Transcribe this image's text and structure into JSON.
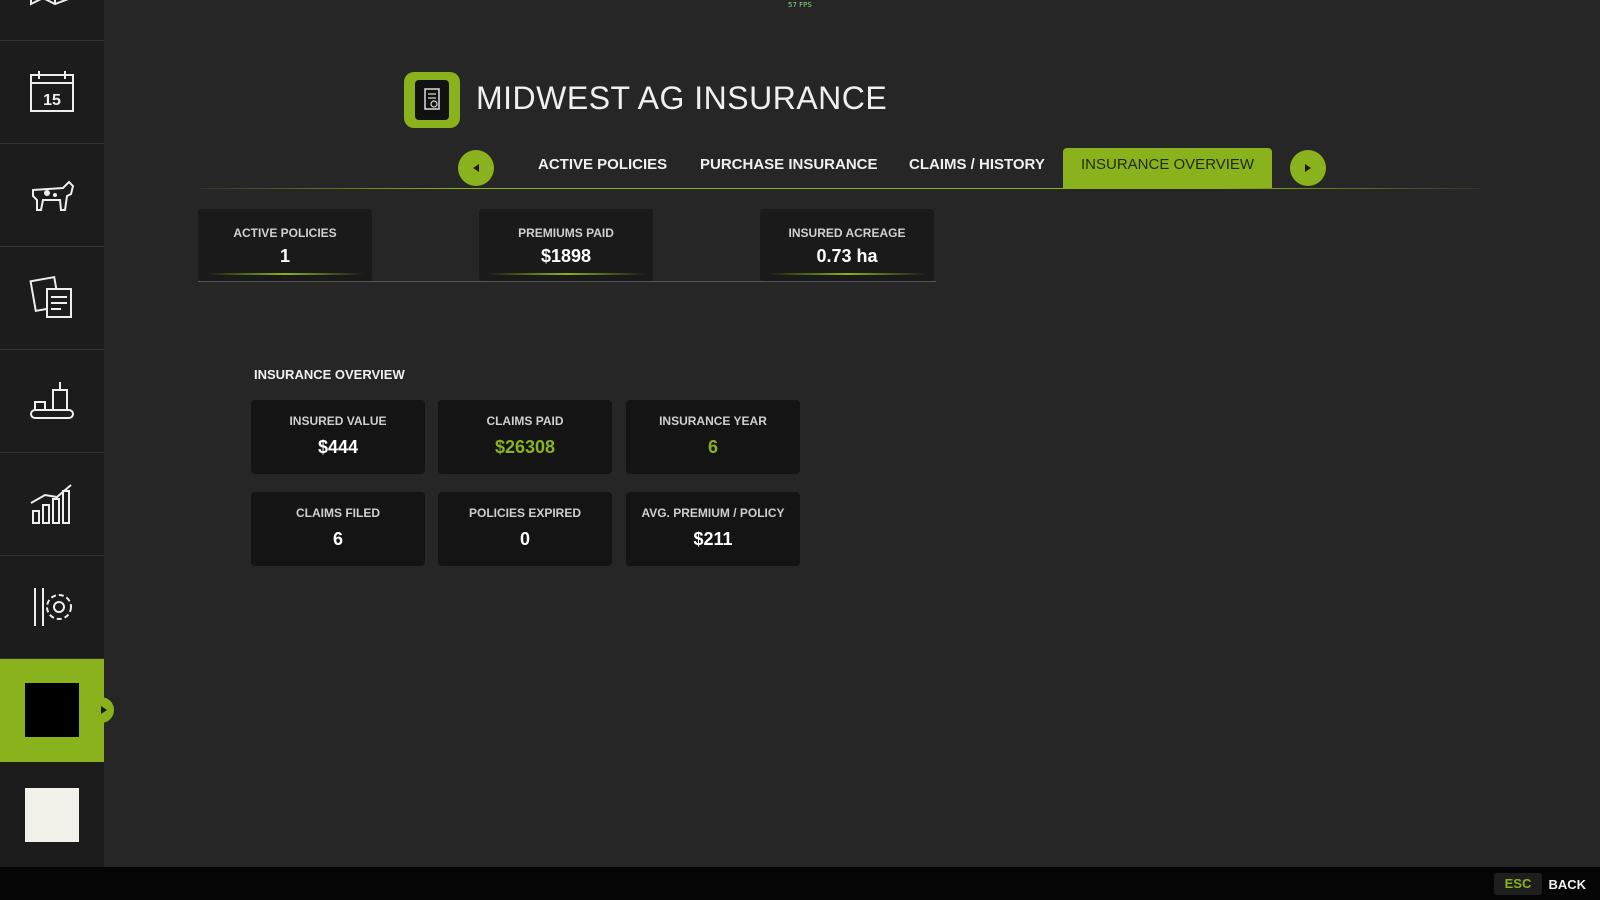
{
  "fps": "57 FPS",
  "sidebar": {
    "items": [
      {
        "icon": "map-icon"
      },
      {
        "icon": "calendar-icon",
        "day": "15"
      },
      {
        "icon": "cow-icon"
      },
      {
        "icon": "contracts-icon"
      },
      {
        "icon": "production-icon"
      },
      {
        "icon": "statistics-icon"
      },
      {
        "icon": "settings-icon"
      },
      {
        "icon": "insurance-icon",
        "active": true
      },
      {
        "icon": "blank-icon"
      }
    ]
  },
  "header": {
    "title": "MIDWEST AG INSURANCE"
  },
  "tabs": [
    {
      "label": "ACTIVE POLICIES"
    },
    {
      "label": "PURCHASE INSURANCE"
    },
    {
      "label": "CLAIMS / HISTORY"
    },
    {
      "label": "INSURANCE OVERVIEW",
      "active": true
    }
  ],
  "stats": [
    {
      "label": "ACTIVE POLICIES",
      "value": "1"
    },
    {
      "label": "PREMIUMS PAID",
      "value": "$1898"
    },
    {
      "label": "INSURED ACREAGE",
      "value": "0.73 ha"
    }
  ],
  "overview": {
    "title": "INSURANCE OVERVIEW",
    "cards": [
      {
        "label": "INSURED VALUE",
        "value": "$444"
      },
      {
        "label": "CLAIMS PAID",
        "value": "$26308",
        "highlight": true
      },
      {
        "label": "INSURANCE YEAR",
        "value": "6",
        "highlight": true
      },
      {
        "label": "CLAIMS FILED",
        "value": "6"
      },
      {
        "label": "POLICIES EXPIRED",
        "value": "0"
      },
      {
        "label": "AVG. PREMIUM / POLICY",
        "value": "$211"
      }
    ]
  },
  "footer": {
    "key": "ESC",
    "action": "BACK"
  },
  "colors": {
    "accent": "#8ab21c",
    "background": "#262626",
    "sidebar": "#1c1c1c"
  }
}
